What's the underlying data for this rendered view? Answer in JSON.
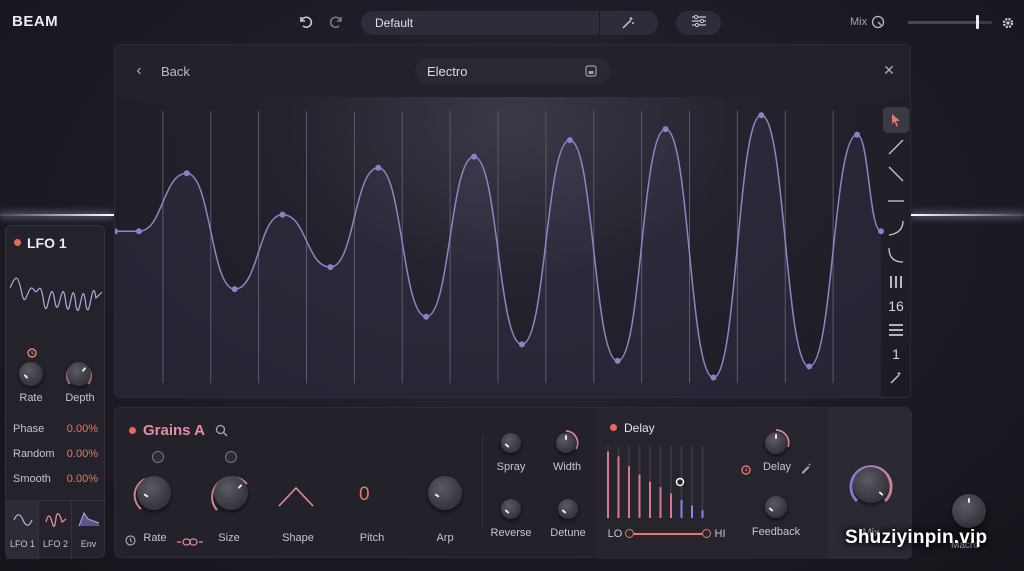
{
  "app": {
    "brand": "BEAM"
  },
  "header": {
    "preset_name": "Default",
    "mix_label": "Mix",
    "mix_value": 0.83
  },
  "editor": {
    "back_label": "Back",
    "shape_name": "Electro",
    "grid_count_a": "16",
    "grid_count_b": "1",
    "tools": [
      "pointer-icon",
      "line-up-icon",
      "line-down-icon",
      "flat-line-icon",
      "curve-convex-icon",
      "curve-concave-icon",
      "grid-icon",
      "list-icon",
      "magic-wand-icon"
    ],
    "wave_points": [
      0.55,
      0.76,
      0.34,
      0.61,
      0.42,
      0.78,
      0.24,
      0.82,
      0.14,
      0.88,
      0.08,
      0.92,
      0.02,
      0.97,
      0.06,
      0.9
    ]
  },
  "lfo": {
    "title": "LFO 1",
    "rate_label": "Rate",
    "depth_label": "Depth",
    "params": [
      {
        "name": "Phase",
        "value": "0.00%"
      },
      {
        "name": "Random",
        "value": "0.00%"
      },
      {
        "name": "Smooth",
        "value": "0.00%"
      }
    ],
    "tabs": [
      "LFO 1",
      "LFO 2",
      "Env"
    ]
  },
  "grains": {
    "title": "Grains A",
    "rate_label": "Rate",
    "size_label": "Size",
    "shape_label": "Shape",
    "pitch_label": "Pitch",
    "pitch_value": "0",
    "arp_label": "Arp",
    "spray_label": "Spray",
    "width_label": "Width",
    "reverse_label": "Reverse",
    "detune_label": "Detune"
  },
  "delay": {
    "title": "Delay",
    "lo_label": "LO",
    "hi_label": "HI",
    "delay_label": "Delay",
    "feedback_label": "Feedback",
    "bars": [
      0.95,
      0.88,
      0.74,
      0.62,
      0.52,
      0.44,
      0.35,
      0.26,
      0.18,
      0.11
    ]
  },
  "mix_panel": {
    "label": "Mix"
  },
  "macro": {
    "label": "Macro"
  },
  "watermark": "Shuziyinpin.vip",
  "colors": {
    "accent_red": "#e0796a",
    "accent_pink": "#e48ca2",
    "wave_purple": "#8e84c4"
  }
}
